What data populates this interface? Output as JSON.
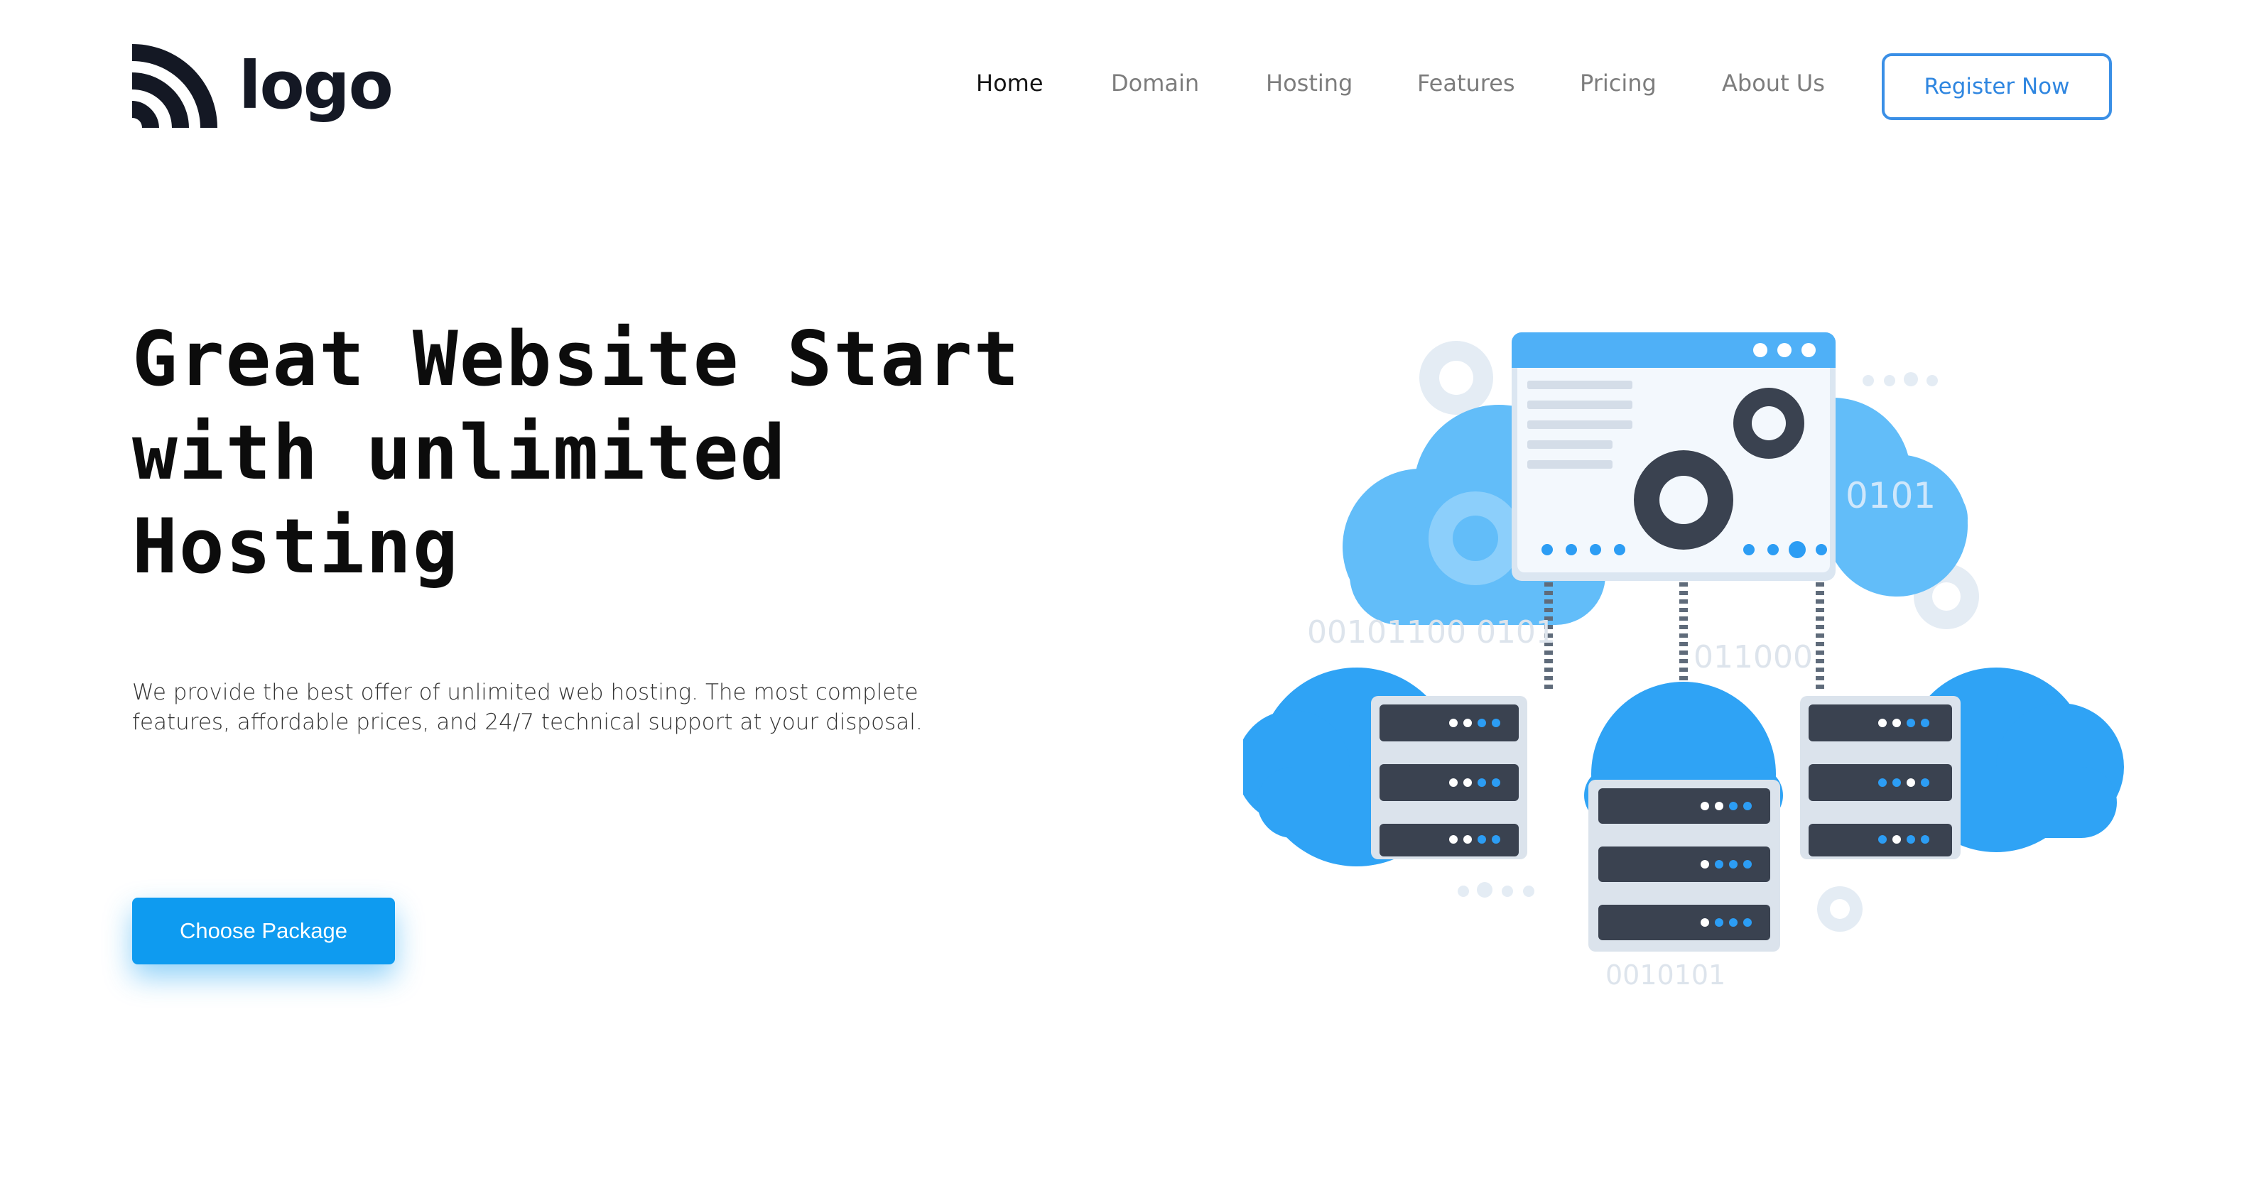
{
  "header": {
    "logo_text": "logo",
    "nav": [
      {
        "label": "Home",
        "active": true
      },
      {
        "label": "Domain",
        "active": false
      },
      {
        "label": "Hosting",
        "active": false
      },
      {
        "label": "Features",
        "active": false
      },
      {
        "label": "Pricing",
        "active": false
      },
      {
        "label": "About Us",
        "active": false
      }
    ],
    "register_label": "Register Now"
  },
  "hero": {
    "title_lines": [
      "Great Website Start",
      "with unlimited",
      "Hosting"
    ],
    "description": "We provide the best offer of unlimited web hosting. The most complete features, affordable prices, and 24/7 technical support at your disposal.",
    "cta_label": "Choose Package"
  },
  "illustration": {
    "binary_labels": [
      "0101",
      "00101100 0101",
      "011000",
      "0010101"
    ]
  },
  "colors": {
    "accent": "#0e9bf0",
    "register_border": "#3a8fe6",
    "cloud_light": "#62bdf9",
    "cloud_dark": "#2fa3f5",
    "server_dark": "#3a4250",
    "gear_dark": "#3a4250",
    "gear_light": "#e4ecf4"
  },
  "icons": {
    "logo": "logo-rss-icon"
  }
}
